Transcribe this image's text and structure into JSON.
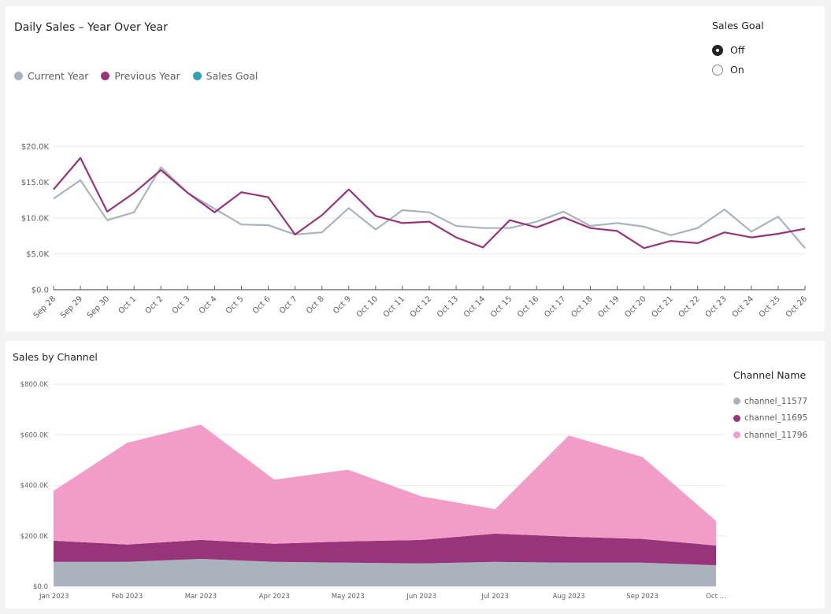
{
  "top_panel": {
    "title": "Daily Sales – Year Over Year",
    "legend": [
      {
        "label": "Current Year",
        "color": "#aab3bd"
      },
      {
        "label": "Previous Year",
        "color": "#98347a"
      },
      {
        "label": "Sales Goal",
        "color": "#2ea3b3"
      }
    ],
    "sales_goal_toggle": {
      "label": "Sales Goal",
      "options": [
        {
          "label": "Off",
          "checked": true
        },
        {
          "label": "On",
          "checked": false
        }
      ]
    }
  },
  "bottom_panel": {
    "title": "Sales by Channel",
    "legend_title": "Channel Name",
    "legend": [
      {
        "label": "channel_11577",
        "color": "#aab3bd"
      },
      {
        "label": "channel_11695",
        "color": "#98347a"
      },
      {
        "label": "channel_11796",
        "color": "#f19dc7"
      }
    ]
  },
  "chart_data": [
    {
      "type": "line",
      "title": "Daily Sales – Year Over Year",
      "xlabel": "",
      "ylabel": "",
      "ylim": [
        0,
        20000
      ],
      "yticks": [
        0,
        5000,
        10000,
        15000,
        20000
      ],
      "ytick_labels": [
        "$0.0",
        "$5.0K",
        "$10.0K",
        "$15.0K",
        "$20.0K"
      ],
      "grid": true,
      "legend_position": "top-left",
      "categories": [
        "Sep 28",
        "Sep 29",
        "Sep 30",
        "Oct 1",
        "Oct 2",
        "Oct 3",
        "Oct 4",
        "Oct 5",
        "Oct 6",
        "Oct 7",
        "Oct 8",
        "Oct 9",
        "Oct 10",
        "Oct 11",
        "Oct 12",
        "Oct 13",
        "Oct 14",
        "Oct 15",
        "Oct 16",
        "Oct 17",
        "Oct 18",
        "Oct 19",
        "Oct 20",
        "Oct 21",
        "Oct 22",
        "Oct 23",
        "Oct 24",
        "Oct 25",
        "Oct 26"
      ],
      "series": [
        {
          "name": "Current Year",
          "color": "#aab3bd",
          "values": [
            12700,
            15300,
            9700,
            10800,
            17100,
            13500,
            11300,
            9100,
            9000,
            7700,
            8000,
            11400,
            8400,
            11100,
            10800,
            8900,
            8600,
            8600,
            9500,
            10900,
            8900,
            9300,
            8800,
            7600,
            8600,
            11200,
            8100,
            10200,
            5800
          ]
        },
        {
          "name": "Previous Year",
          "color": "#98347a",
          "values": [
            14000,
            18400,
            10900,
            13500,
            16700,
            13500,
            10800,
            13600,
            12900,
            7700,
            10400,
            14000,
            10300,
            9300,
            9500,
            7300,
            5900,
            9700,
            8700,
            10100,
            8600,
            8200,
            5800,
            6800,
            6500,
            8000,
            7300,
            7800,
            8500
          ]
        },
        {
          "name": "Sales Goal",
          "color": "#2ea3b3",
          "values": []
        }
      ]
    },
    {
      "type": "area",
      "stacked": true,
      "title": "Sales by Channel",
      "xlabel": "",
      "ylabel": "",
      "ylim": [
        0,
        800000
      ],
      "yticks": [
        0,
        200000,
        400000,
        600000,
        800000
      ],
      "ytick_labels": [
        "$0.0",
        "$200.0K",
        "$400.0K",
        "$600.0K",
        "$800.0K"
      ],
      "grid": true,
      "legend_position": "right",
      "legend_title": "Channel Name",
      "categories": [
        "Jan 2023",
        "Feb 2023",
        "Mar 2023",
        "Apr 2023",
        "May 2023",
        "Jun 2023",
        "Jul 2023",
        "Aug 2023",
        "Sep 2023",
        "Oct ..."
      ],
      "series": [
        {
          "name": "channel_11577",
          "color": "#aab3bd",
          "values": [
            97000,
            97000,
            109000,
            97000,
            94000,
            91000,
            97000,
            94000,
            94000,
            84000
          ]
        },
        {
          "name": "channel_11695",
          "color": "#98347a",
          "values": [
            84000,
            69000,
            75000,
            72000,
            84000,
            93000,
            112000,
            103000,
            94000,
            78000
          ]
        },
        {
          "name": "channel_11796",
          "color": "#f19dc7",
          "values": [
            197000,
            402000,
            456000,
            253000,
            284000,
            172000,
            97000,
            400000,
            324000,
            97000
          ]
        }
      ]
    }
  ]
}
